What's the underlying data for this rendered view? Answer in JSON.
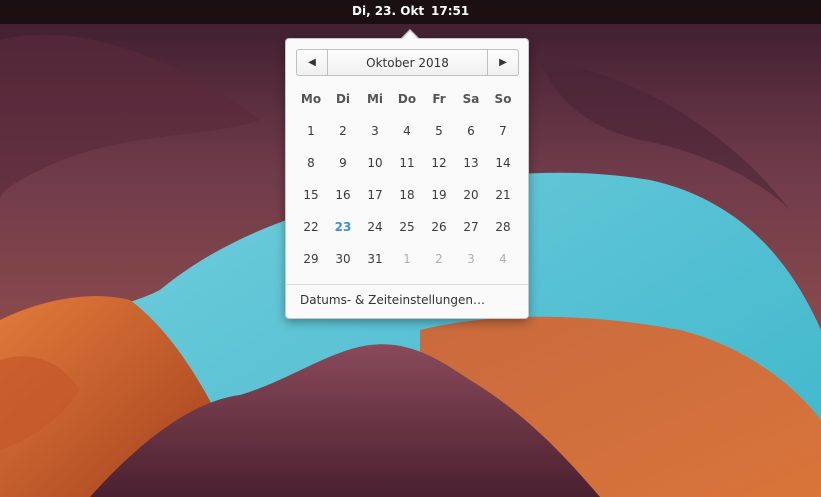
{
  "topbar": {
    "date": "Di, 23. Okt",
    "time": "17:51"
  },
  "calendar": {
    "month_label": "Oktober 2018",
    "prev_icon": "chevron-left-icon",
    "next_icon": "chevron-right-icon",
    "weekdays": [
      "Mo",
      "Di",
      "Mi",
      "Do",
      "Fr",
      "Sa",
      "So"
    ],
    "weeks": [
      [
        "1",
        "2",
        "3",
        "4",
        "5",
        "6",
        "7"
      ],
      [
        "8",
        "9",
        "10",
        "11",
        "12",
        "13",
        "14"
      ],
      [
        "15",
        "16",
        "17",
        "18",
        "19",
        "20",
        "21"
      ],
      [
        "22",
        "23",
        "24",
        "25",
        "26",
        "27",
        "28"
      ],
      [
        "29",
        "30",
        "31",
        "1",
        "2",
        "3",
        "4"
      ]
    ],
    "today": "23",
    "today_color": "#3d8fe0"
  },
  "settings_link": "Datums- & Zeiteinstellungen…"
}
